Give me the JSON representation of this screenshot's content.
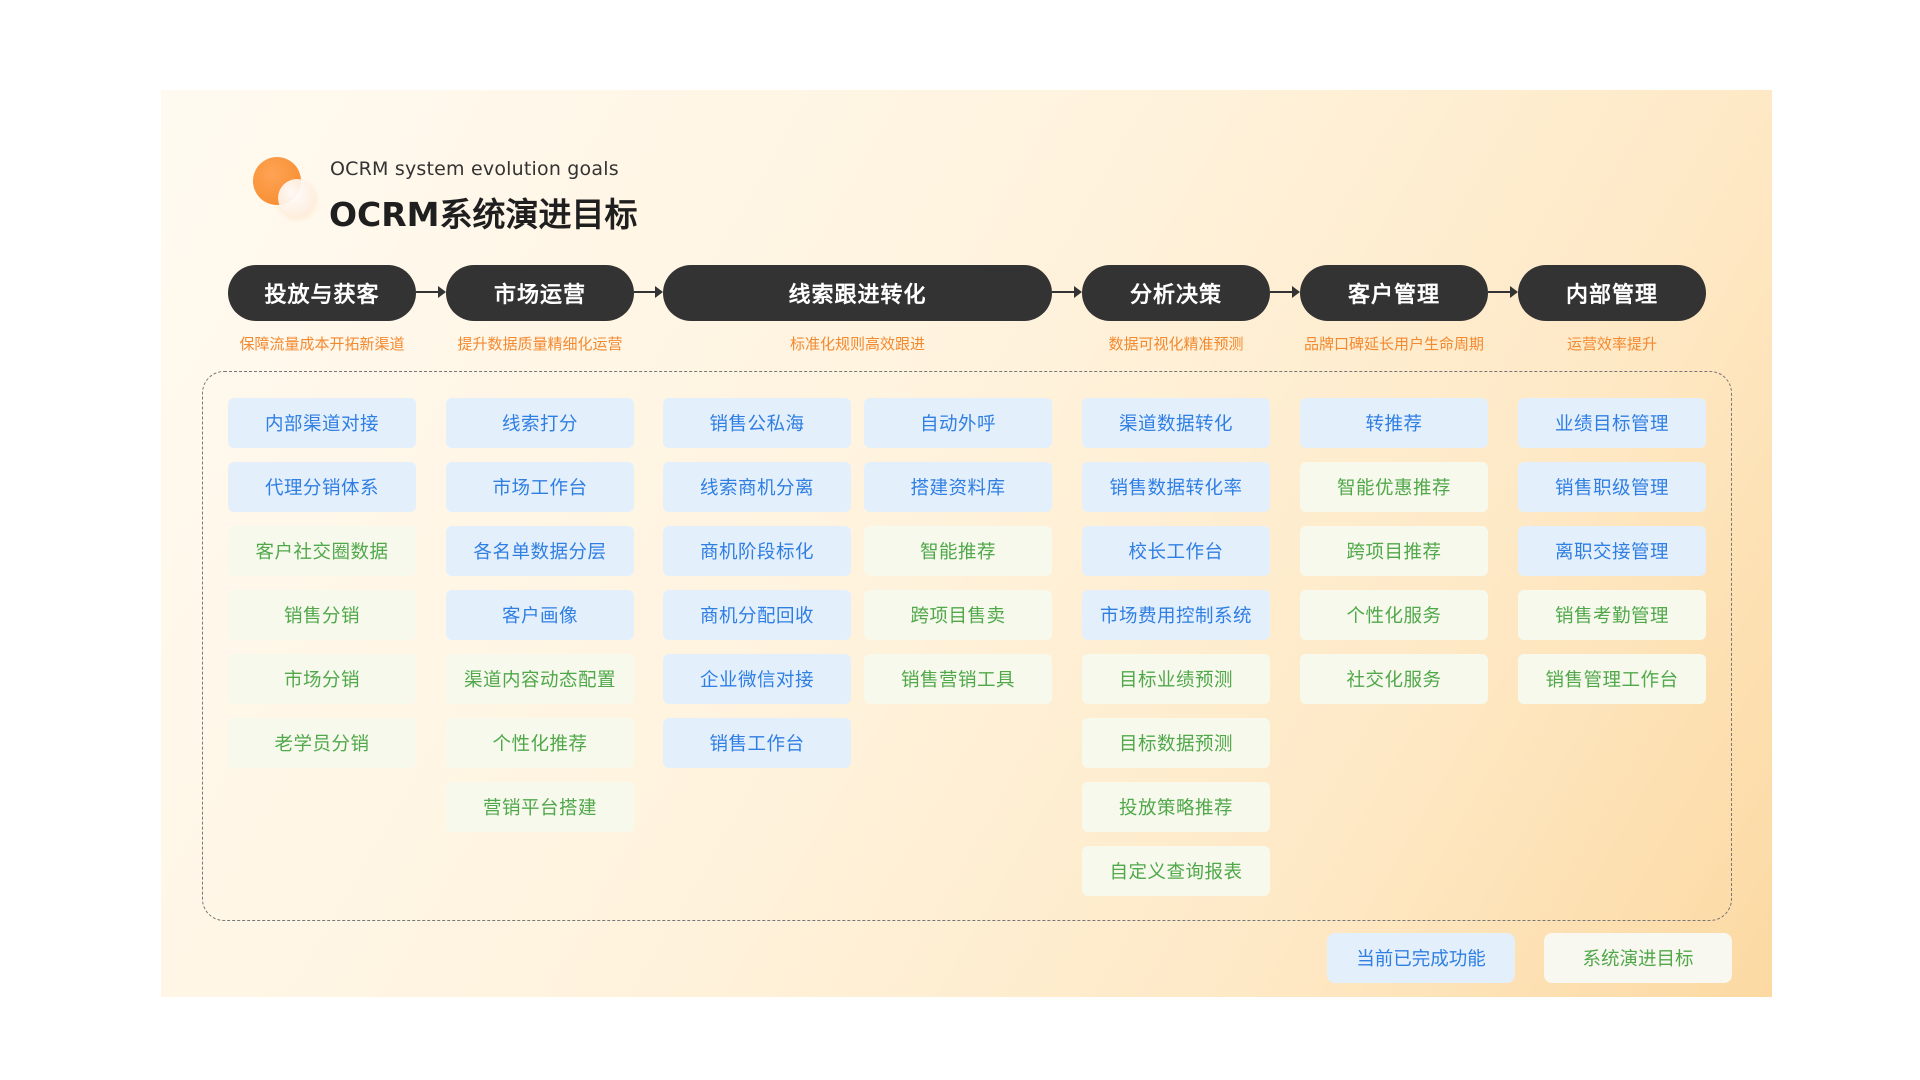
{
  "header": {
    "subtitle": "OCRM system evolution goals",
    "title": "OCRM系统演进目标"
  },
  "phases": [
    {
      "label": "投放与获客",
      "goal": "保障流量成本开拓新渠道"
    },
    {
      "label": "市场运营",
      "goal": "提升数据质量精细化运营"
    },
    {
      "label": "线索跟进转化",
      "goal": "标准化规则高效跟进"
    },
    {
      "label": "分析决策",
      "goal": "数据可视化精准预测"
    },
    {
      "label": "客户管理",
      "goal": "品牌口碑延长用户生命周期"
    },
    {
      "label": "内部管理",
      "goal": "运营效率提升"
    }
  ],
  "columns": [
    {
      "items": [
        {
          "label": "内部渠道对接",
          "status": "done"
        },
        {
          "label": "代理分销体系",
          "status": "done"
        },
        {
          "label": "客户社交圈数据",
          "status": "target"
        },
        {
          "label": "销售分销",
          "status": "target"
        },
        {
          "label": "市场分销",
          "status": "target"
        },
        {
          "label": "老学员分销",
          "status": "target"
        }
      ]
    },
    {
      "items": [
        {
          "label": "线索打分",
          "status": "done"
        },
        {
          "label": "市场工作台",
          "status": "done"
        },
        {
          "label": "各名单数据分层",
          "status": "done"
        },
        {
          "label": "客户画像",
          "status": "done"
        },
        {
          "label": "渠道内容动态配置",
          "status": "target"
        },
        {
          "label": "个性化推荐",
          "status": "target"
        },
        {
          "label": "营销平台搭建",
          "status": "target"
        }
      ]
    },
    {
      "items": [
        {
          "label": "销售公私海",
          "status": "done"
        },
        {
          "label": "线索商机分离",
          "status": "done"
        },
        {
          "label": "商机阶段标化",
          "status": "done"
        },
        {
          "label": "商机分配回收",
          "status": "done"
        },
        {
          "label": "企业微信对接",
          "status": "done"
        },
        {
          "label": "销售工作台",
          "status": "done"
        }
      ]
    },
    {
      "items": [
        {
          "label": "自动外呼",
          "status": "done"
        },
        {
          "label": "搭建资料库",
          "status": "done"
        },
        {
          "label": "智能推荐",
          "status": "target"
        },
        {
          "label": "跨项目售卖",
          "status": "target"
        },
        {
          "label": "销售营销工具",
          "status": "target"
        }
      ]
    },
    {
      "items": [
        {
          "label": "渠道数据转化",
          "status": "done"
        },
        {
          "label": "销售数据转化率",
          "status": "done"
        },
        {
          "label": "校长工作台",
          "status": "done"
        },
        {
          "label": "市场费用控制系统",
          "status": "done"
        },
        {
          "label": "目标业绩预测",
          "status": "target"
        },
        {
          "label": "目标数据预测",
          "status": "target"
        },
        {
          "label": "投放策略推荐",
          "status": "target"
        },
        {
          "label": "自定义查询报表",
          "status": "target"
        }
      ]
    },
    {
      "items": [
        {
          "label": "转推荐",
          "status": "done"
        },
        {
          "label": "智能优惠推荐",
          "status": "target"
        },
        {
          "label": "跨项目推荐",
          "status": "target"
        },
        {
          "label": "个性化服务",
          "status": "target"
        },
        {
          "label": "社交化服务",
          "status": "target"
        }
      ]
    },
    {
      "items": [
        {
          "label": "业绩目标管理",
          "status": "done"
        },
        {
          "label": "销售职级管理",
          "status": "done"
        },
        {
          "label": "离职交接管理",
          "status": "done"
        },
        {
          "label": "销售考勤管理",
          "status": "target"
        },
        {
          "label": "销售管理工作台",
          "status": "target"
        }
      ]
    }
  ],
  "legend": {
    "done_label": "当前已完成功能",
    "target_label": "系统演进目标"
  },
  "colors": {
    "done_text": "#2f7fe3",
    "done_bg": "#e4effc",
    "target_text": "#51a84b",
    "target_bg": "#f6f9ec",
    "goal_text": "#f3892f",
    "phase_bg": "#333333"
  }
}
